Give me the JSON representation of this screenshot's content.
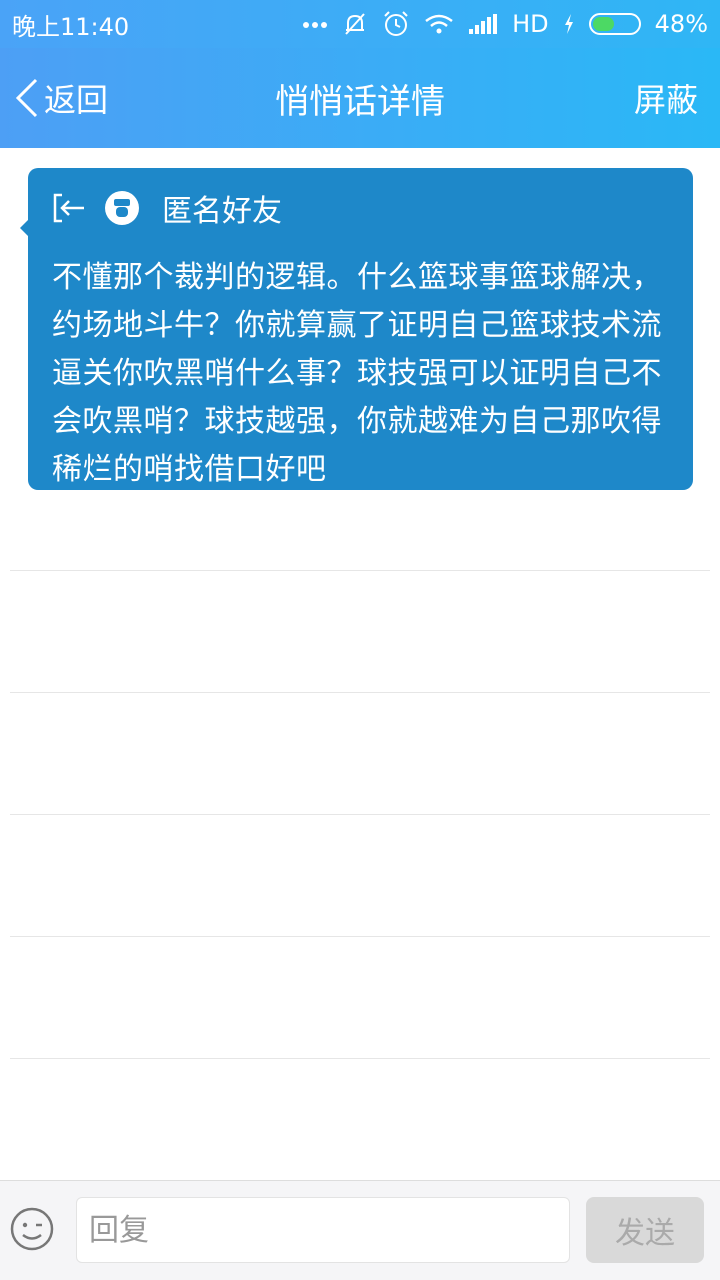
{
  "status_bar": {
    "time": "晚上11:40",
    "network": "HD",
    "battery_percent": "48%",
    "battery_level": 0.48
  },
  "header": {
    "back_label": "返回",
    "title": "悄悄话详情",
    "right_action": "屏蔽"
  },
  "message": {
    "sender": "匿名好友",
    "text": "不懂那个裁判的逻辑。什么篮球事篮球解决，约场地斗牛？你就算赢了证明自己篮球技术流逼关你吹黑哨什么事？球技强可以证明自己不会吹黑哨？球技越强，你就越难为自己那吹得稀烂的哨找借口好吧"
  },
  "reply_bar": {
    "placeholder": "回复",
    "send_label": "发送"
  },
  "colors": {
    "header_start": "#4d9ff5",
    "header_end": "#2ab8f6",
    "bubble": "#1e88c9",
    "send_disabled": "#d9d9d9"
  }
}
